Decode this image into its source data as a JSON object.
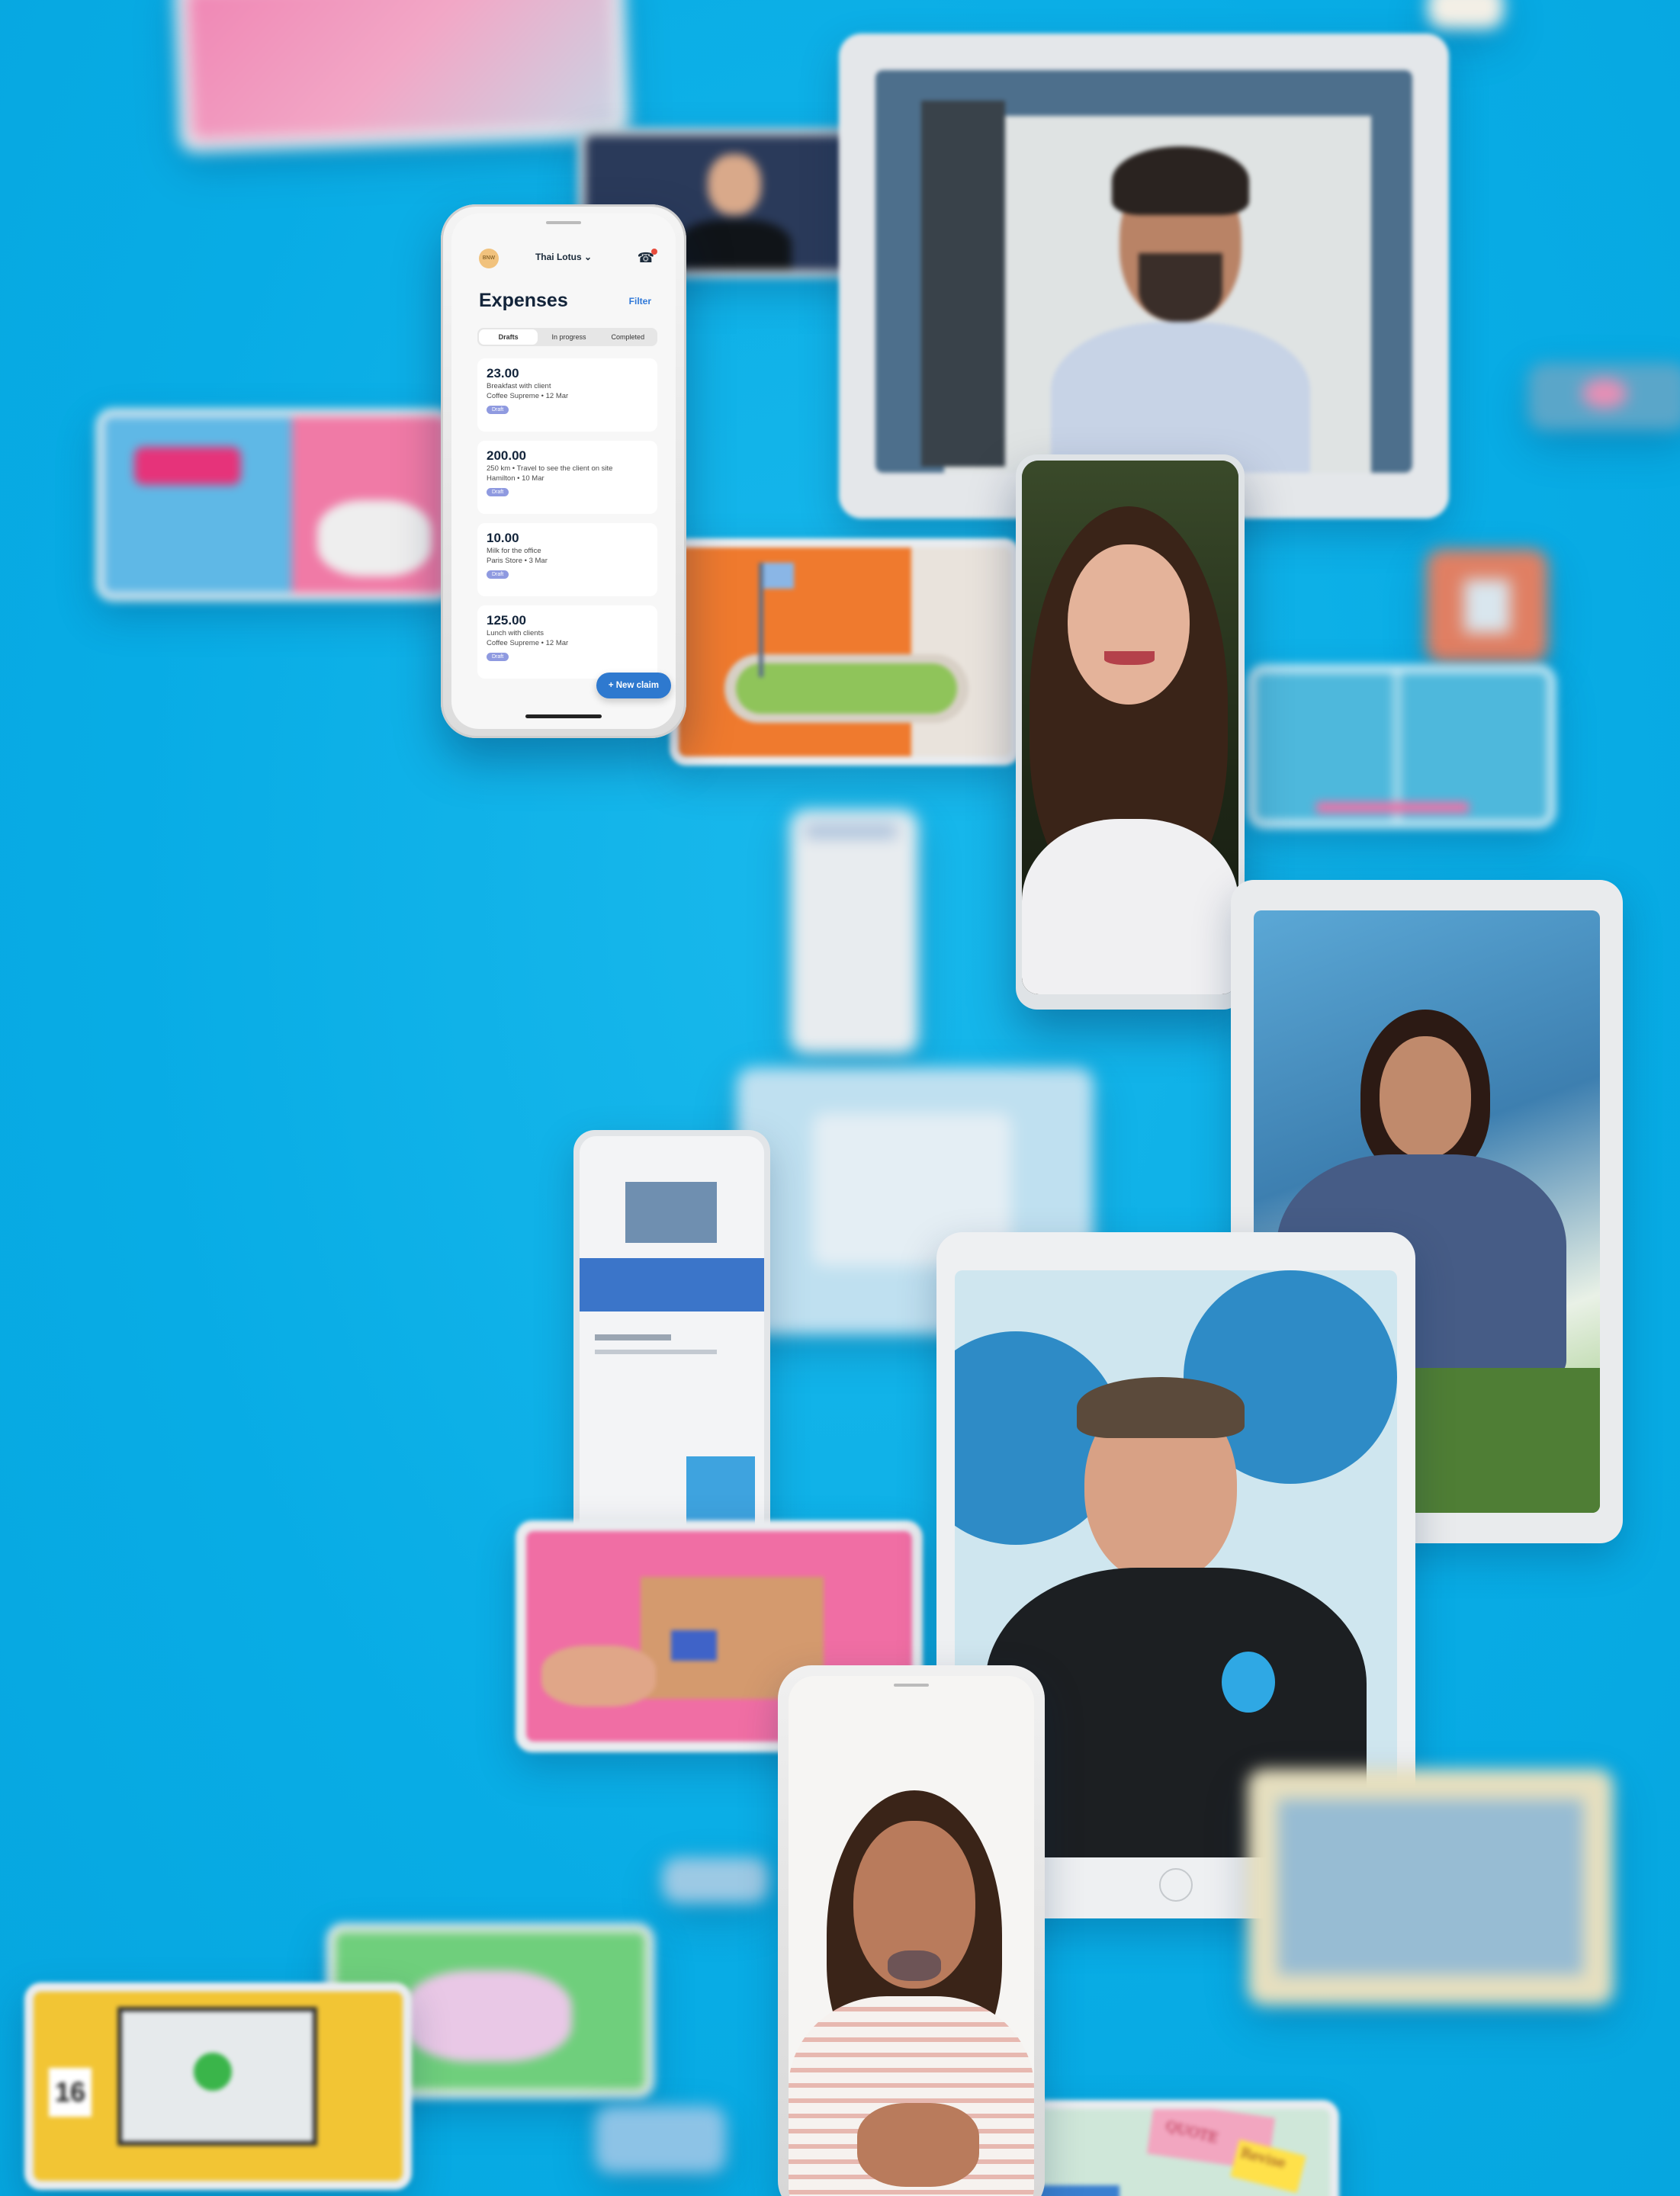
{
  "expenses_app": {
    "org_avatar_text": "BNW",
    "org_name": "Thai Lotus ⌄",
    "title": "Expenses",
    "filter_label": "Filter",
    "tabs": [
      "Drafts",
      "In progress",
      "Completed"
    ],
    "items": [
      {
        "amount": "23.00",
        "desc": "Breakfast with client",
        "meta": "Coffee Supreme • 12 Mar",
        "status": "Draft"
      },
      {
        "amount": "200.00",
        "desc": "250 km • Travel to see the client on site",
        "meta": "Hamilton • 10 Mar",
        "status": "Draft"
      },
      {
        "amount": "10.00",
        "desc": "Milk for the office",
        "meta": "Paris Store • 3 Mar",
        "status": "Draft"
      },
      {
        "amount": "125.00",
        "desc": "Lunch with clients",
        "meta": "Coffee Supreme • 12 Mar",
        "status": "Draft"
      }
    ],
    "new_claim_label": "+ New claim"
  },
  "colors": {
    "background": "#0ab1e8",
    "accent_blue": "#2e79cf",
    "badge": "#8f9ae0"
  },
  "background_text": {
    "calendar_number": "16",
    "sticky_note_1": "QUOTE",
    "sticky_note_2": "Revise"
  }
}
